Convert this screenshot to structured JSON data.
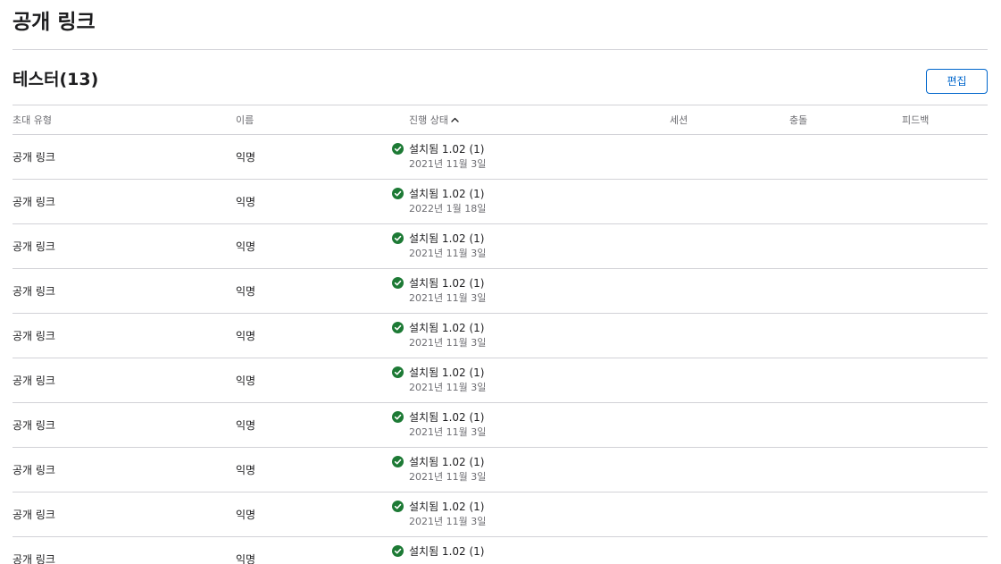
{
  "page": {
    "title": "공개 링크"
  },
  "section": {
    "title": "테스터(13)",
    "edit_label": "편집"
  },
  "table": {
    "columns": {
      "invite_type": "초대 유형",
      "name": "이름",
      "status": "진행 상태",
      "session": "세션",
      "crash": "충돌",
      "feedback": "피드백"
    },
    "sort": {
      "column": "status",
      "direction": "ascending"
    },
    "status_color": "#1d7a35",
    "rows": [
      {
        "invite_type": "공개 링크",
        "name": "익명",
        "status": "설치됨 1.02 (1)",
        "date": "2021년 11월 3일"
      },
      {
        "invite_type": "공개 링크",
        "name": "익명",
        "status": "설치됨 1.02 (1)",
        "date": "2022년 1월 18일"
      },
      {
        "invite_type": "공개 링크",
        "name": "익명",
        "status": "설치됨 1.02 (1)",
        "date": "2021년 11월 3일"
      },
      {
        "invite_type": "공개 링크",
        "name": "익명",
        "status": "설치됨 1.02 (1)",
        "date": "2021년 11월 3일"
      },
      {
        "invite_type": "공개 링크",
        "name": "익명",
        "status": "설치됨 1.02 (1)",
        "date": "2021년 11월 3일"
      },
      {
        "invite_type": "공개 링크",
        "name": "익명",
        "status": "설치됨 1.02 (1)",
        "date": "2021년 11월 3일"
      },
      {
        "invite_type": "공개 링크",
        "name": "익명",
        "status": "설치됨 1.02 (1)",
        "date": "2021년 11월 3일"
      },
      {
        "invite_type": "공개 링크",
        "name": "익명",
        "status": "설치됨 1.02 (1)",
        "date": "2021년 11월 3일"
      },
      {
        "invite_type": "공개 링크",
        "name": "익명",
        "status": "설치됨 1.02 (1)",
        "date": "2021년 11월 3일"
      },
      {
        "invite_type": "공개 링크",
        "name": "익명",
        "status": "설치됨 1.02 (1)",
        "date": ""
      }
    ]
  }
}
